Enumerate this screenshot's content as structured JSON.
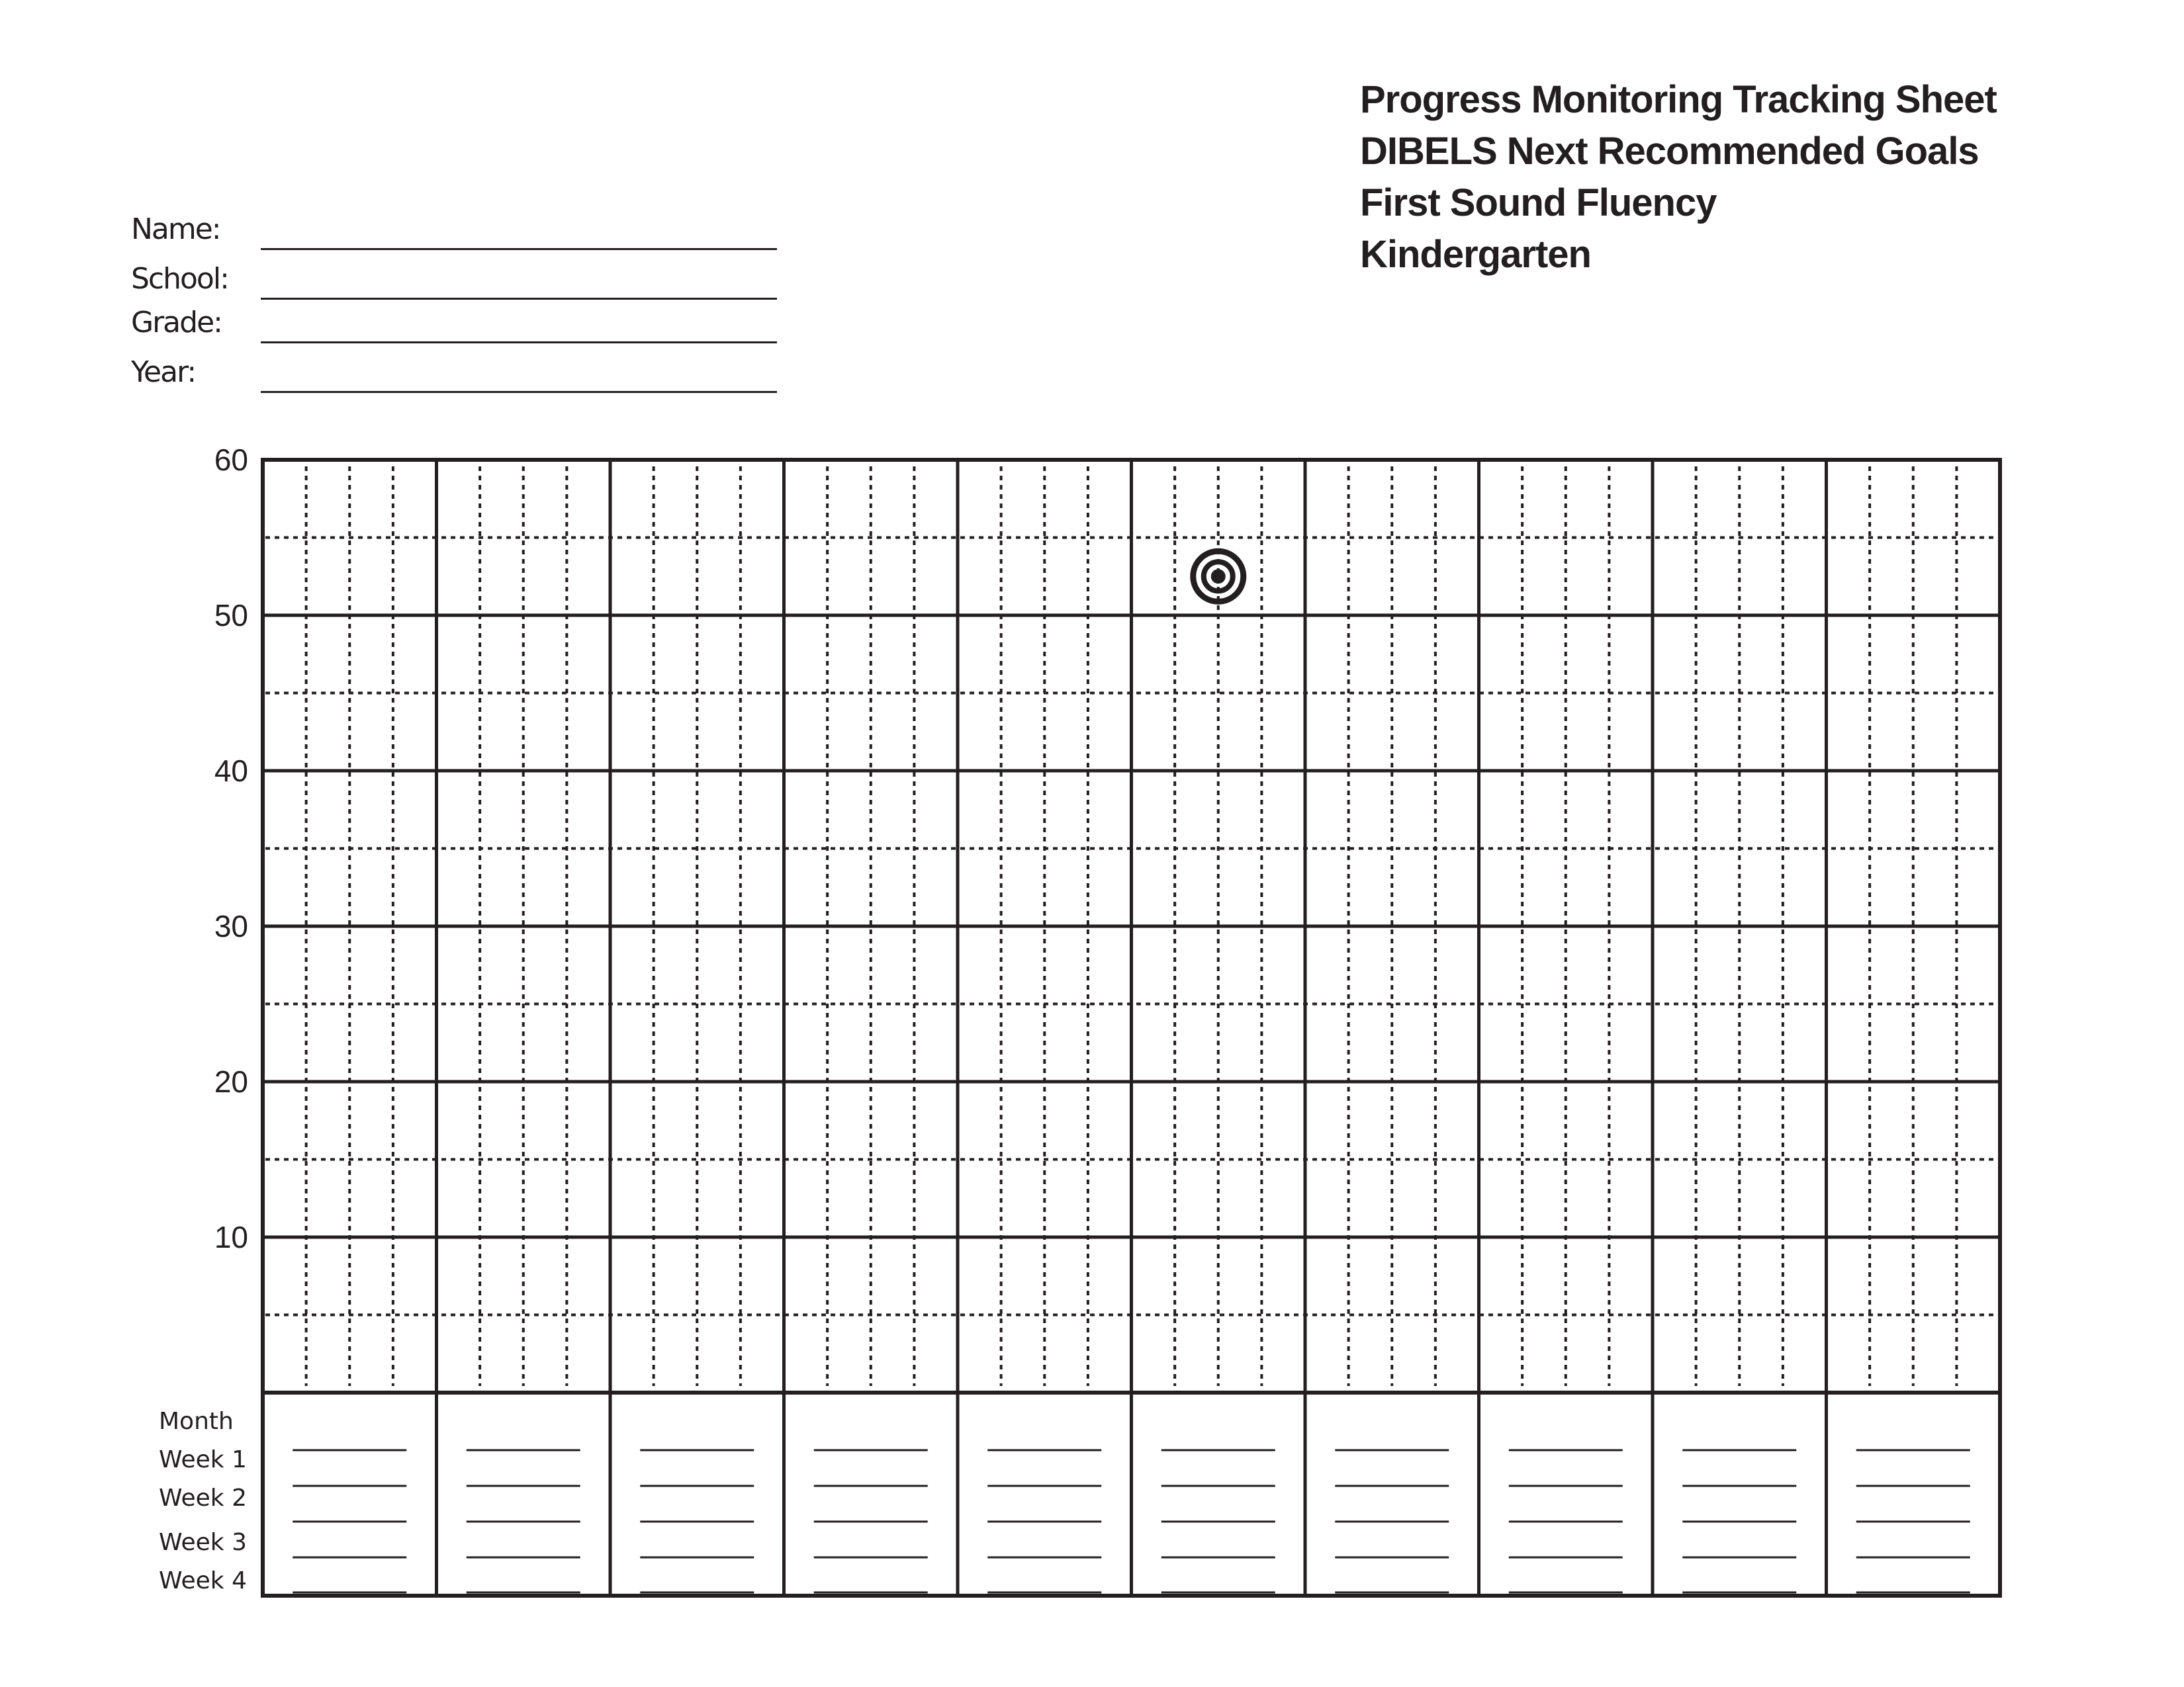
{
  "title_lines": [
    "Progress Monitoring Tracking Sheet",
    "DIBELS Next Recommended Goals",
    "First Sound Fluency",
    "Kindergarten"
  ],
  "form_fields": [
    {
      "label": "Name:",
      "value": ""
    },
    {
      "label": "School:",
      "value": ""
    },
    {
      "label": "Grade:",
      "value": ""
    },
    {
      "label": "Year:",
      "value": ""
    }
  ],
  "chart_data": {
    "type": "scatter",
    "title": "Progress Monitoring Tracking Sheet",
    "xlabel": "",
    "ylabel": "",
    "ylim": [
      0,
      60
    ],
    "y_ticks": [
      60,
      50,
      40,
      30,
      20,
      10
    ],
    "y_minor_step": 5,
    "months": 10,
    "weeks_per_month": 4,
    "grid": true,
    "row_labels": [
      "Month",
      "Week 1",
      "Week 2",
      "Week 3",
      "Week 4"
    ],
    "goal_marker": {
      "icon": "target-icon",
      "month": 6,
      "week": 2,
      "value": 52.5
    },
    "series": []
  },
  "colors": {
    "ink": "#231f20",
    "background": "#ffffff"
  }
}
